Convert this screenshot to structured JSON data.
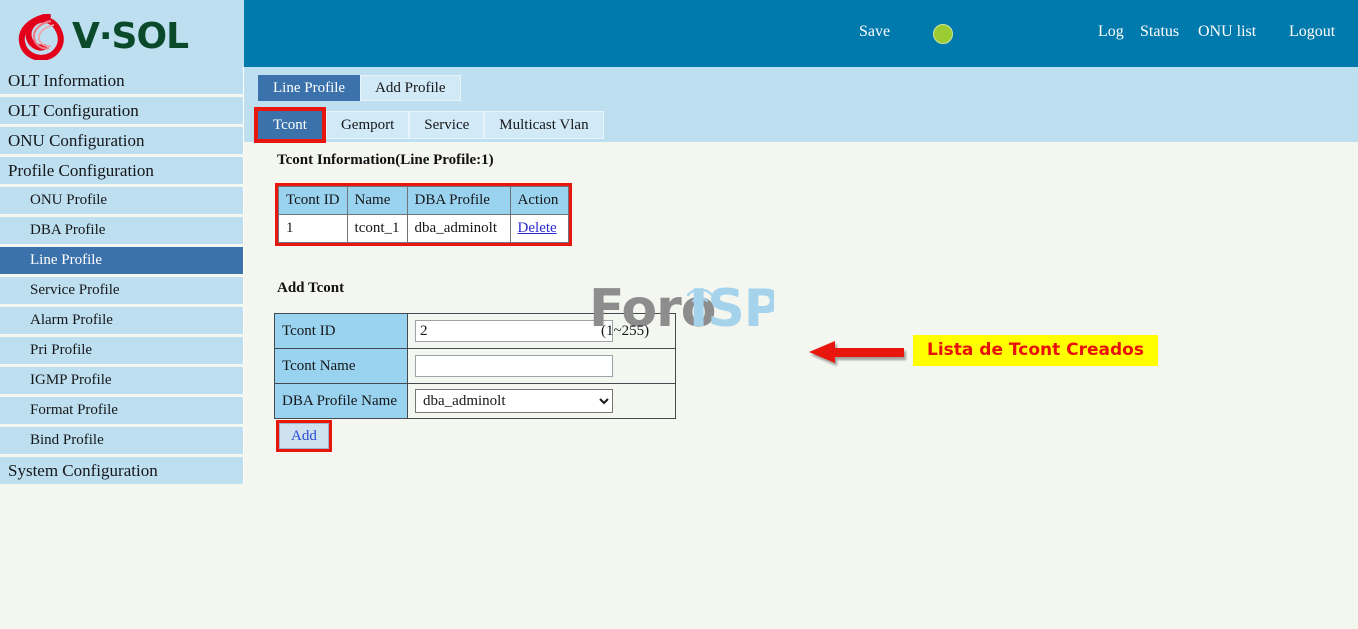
{
  "brand": {
    "name": "V·SOL",
    "logo_icon": "vsol-droplet-logo",
    "accent_blue": "#0079ac",
    "panel_blue": "#bddff0"
  },
  "header": {
    "save_label": "Save",
    "status_indicator": {
      "icon": "status-dot-icon",
      "color": "#9ccc33"
    },
    "nav": [
      {
        "label": "Log",
        "name": "log"
      },
      {
        "label": "Status",
        "name": "status"
      },
      {
        "label": "ONU list",
        "name": "onu-list"
      },
      {
        "label": "Logout",
        "name": "logout"
      }
    ]
  },
  "sidebar": {
    "items": [
      {
        "label": "OLT Information",
        "level": "top",
        "active": false
      },
      {
        "label": "OLT Configuration",
        "level": "top",
        "active": false
      },
      {
        "label": "ONU Configuration",
        "level": "top",
        "active": false
      },
      {
        "label": "Profile Configuration",
        "level": "top",
        "active": false
      },
      {
        "label": "ONU Profile",
        "level": "sub",
        "active": false
      },
      {
        "label": "DBA Profile",
        "level": "sub",
        "active": false
      },
      {
        "label": "Line Profile",
        "level": "sub",
        "active": true
      },
      {
        "label": "Service Profile",
        "level": "sub",
        "active": false
      },
      {
        "label": "Alarm Profile",
        "level": "sub",
        "active": false
      },
      {
        "label": "Pri Profile",
        "level": "sub",
        "active": false
      },
      {
        "label": "IGMP Profile",
        "level": "sub",
        "active": false
      },
      {
        "label": "Format Profile",
        "level": "sub",
        "active": false
      },
      {
        "label": "Bind Profile",
        "level": "sub",
        "active": false
      },
      {
        "label": "System Configuration",
        "level": "top",
        "active": false
      }
    ]
  },
  "tabs_primary": [
    {
      "label": "Line Profile",
      "active": true,
      "highlight": false
    },
    {
      "label": "Add Profile",
      "active": false,
      "highlight": false
    }
  ],
  "tabs_secondary": [
    {
      "label": "Tcont",
      "active": true,
      "highlight": true
    },
    {
      "label": "Gemport",
      "active": false,
      "highlight": false
    },
    {
      "label": "Service",
      "active": false,
      "highlight": false
    },
    {
      "label": "Multicast Vlan",
      "active": false,
      "highlight": false
    }
  ],
  "tcont_info": {
    "title": "Tcont Information(Line Profile:1)",
    "columns": [
      "Tcont ID",
      "Name",
      "DBA Profile",
      "Action"
    ],
    "rows": [
      {
        "id": "1",
        "name": "tcont_1",
        "dba_profile": "dba_adminolt",
        "action": "Delete"
      }
    ]
  },
  "annotation": {
    "text": "Lista de Tcont Creados",
    "box_color": "#ffff00",
    "text_color": "#e8100a",
    "arrow_icon": "left-arrow-icon",
    "arrow_color": "#e8160c"
  },
  "watermark": {
    "part1": "Foro",
    "part2": "ISP",
    "icon": "wifi-signal-icon"
  },
  "add_tcont": {
    "title": "Add Tcont",
    "fields": {
      "tcont_id": {
        "label": "Tcont ID",
        "value": "2",
        "placeholder": "",
        "hint": "(1~255)"
      },
      "tcont_name": {
        "label": "Tcont Name",
        "value": "",
        "placeholder": ""
      },
      "dba_profile_name": {
        "label": "DBA Profile Name",
        "value": "dba_adminolt",
        "options": [
          "dba_adminolt"
        ]
      }
    },
    "add_button": "Add"
  }
}
